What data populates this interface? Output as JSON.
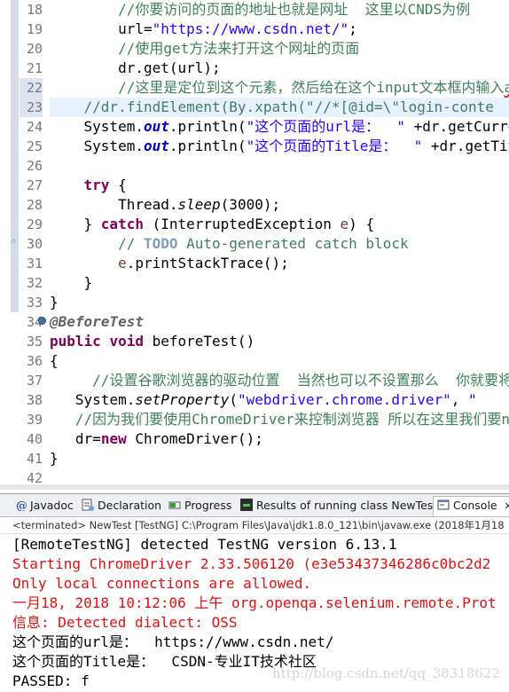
{
  "editor": {
    "line_numbers": [
      "18",
      "19",
      "20",
      "21",
      "22",
      "23",
      "24",
      "25",
      "26",
      "27",
      "28",
      "29",
      "30",
      "31",
      "32",
      "33",
      "34",
      "35",
      "36",
      "37",
      "38",
      "39",
      "40",
      "41",
      "42"
    ],
    "lines": [
      {
        "indent": "        ",
        "tokens": [
          {
            "t": "//你要访问的页面的地址也就是网址  这里以CNDS为例",
            "c": "cmt"
          }
        ]
      },
      {
        "indent": "        ",
        "tokens": [
          {
            "t": "url=",
            "c": ""
          },
          {
            "t": "\"https://www.csdn.net/\"",
            "c": "str"
          },
          {
            "t": ";",
            "c": ""
          }
        ]
      },
      {
        "indent": "        ",
        "tokens": [
          {
            "t": "//使用get方法来打开这个网址的页面",
            "c": "cmt"
          }
        ]
      },
      {
        "indent": "        ",
        "tokens": [
          {
            "t": "dr.get(url);",
            "c": ""
          }
        ]
      },
      {
        "indent": "        ",
        "tokens": [
          {
            "t": "//这里是定位到这个元素，然后给在这个input文本框内输入",
            "c": "cmt"
          },
          {
            "t": "admin",
            "c": "cmt squiggle"
          }
        ]
      },
      {
        "indent": "    ",
        "tokens": [
          {
            "t": "//dr.findElement(By.xpath(\"//*[@id=\\\"login-conte",
            "c": "cmt"
          }
        ]
      },
      {
        "indent": "    ",
        "tokens": [
          {
            "t": "System.",
            "c": ""
          },
          {
            "t": "out",
            "c": "field"
          },
          {
            "t": ".println(",
            "c": ""
          },
          {
            "t": "\"这个页面的url是：  \"",
            "c": "str"
          },
          {
            "t": " +dr.getCurre",
            "c": ""
          }
        ]
      },
      {
        "indent": "    ",
        "tokens": [
          {
            "t": "System.",
            "c": ""
          },
          {
            "t": "out",
            "c": "field"
          },
          {
            "t": ".println(",
            "c": ""
          },
          {
            "t": "\"这个页面的Title是：  \"",
            "c": "str"
          },
          {
            "t": " +dr.getTit",
            "c": ""
          }
        ]
      },
      {
        "indent": "",
        "tokens": []
      },
      {
        "indent": "    ",
        "tokens": [
          {
            "t": "try",
            "c": "kw"
          },
          {
            "t": " {",
            "c": ""
          }
        ]
      },
      {
        "indent": "        ",
        "tokens": [
          {
            "t": "Thread.",
            "c": ""
          },
          {
            "t": "sleep",
            "c": "smeth"
          },
          {
            "t": "(3000);",
            "c": ""
          }
        ]
      },
      {
        "indent": "    ",
        "tokens": [
          {
            "t": "} ",
            "c": ""
          },
          {
            "t": "catch",
            "c": "kw"
          },
          {
            "t": " (InterruptedException ",
            "c": ""
          },
          {
            "t": "e",
            "c": "var"
          },
          {
            "t": ") {",
            "c": ""
          }
        ]
      },
      {
        "indent": "        ",
        "tokens": [
          {
            "t": "// ",
            "c": "cmt"
          },
          {
            "t": "TODO",
            "c": "todo"
          },
          {
            "t": " Auto-generated catch block",
            "c": "cmt"
          }
        ]
      },
      {
        "indent": "        ",
        "tokens": [
          {
            "t": "e",
            "c": "var"
          },
          {
            "t": ".printStackTrace();",
            "c": ""
          }
        ]
      },
      {
        "indent": "    ",
        "tokens": [
          {
            "t": "}",
            "c": ""
          }
        ]
      },
      {
        "indent": "",
        "tokens": [
          {
            "t": "}",
            "c": ""
          }
        ]
      },
      {
        "indent": "",
        "tokens": [
          {
            "t": "@BeforeTest",
            "c": "ann"
          }
        ]
      },
      {
        "indent": "",
        "tokens": [
          {
            "t": "public",
            "c": "kw"
          },
          {
            "t": " ",
            "c": ""
          },
          {
            "t": "void",
            "c": "kw"
          },
          {
            "t": " beforeTest()",
            "c": ""
          }
        ]
      },
      {
        "indent": "",
        "tokens": [
          {
            "t": "{",
            "c": ""
          }
        ]
      },
      {
        "indent": "     ",
        "tokens": [
          {
            "t": "//设置谷歌浏览器的驱动位置  当然也可以不设置那么  你就要将这个",
            "c": "cmt"
          }
        ]
      },
      {
        "indent": "   ",
        "tokens": [
          {
            "t": "System.",
            "c": ""
          },
          {
            "t": "setProperty",
            "c": "smeth"
          },
          {
            "t": "(",
            "c": ""
          },
          {
            "t": "\"webdriver.chrome.driver\"",
            "c": "str"
          },
          {
            "t": ", ",
            "c": ""
          },
          {
            "t": "\"",
            "c": "str"
          }
        ]
      },
      {
        "indent": "   ",
        "tokens": [
          {
            "t": "//因为我们要使用ChromeDriver来控制浏览器 所以在这里我们要n",
            "c": "cmt"
          }
        ]
      },
      {
        "indent": "   ",
        "tokens": [
          {
            "t": "dr=",
            "c": ""
          },
          {
            "t": "new",
            "c": "kw"
          },
          {
            "t": " ChromeDriver();",
            "c": ""
          }
        ]
      },
      {
        "indent": "",
        "tokens": [
          {
            "t": "}",
            "c": ""
          }
        ]
      },
      {
        "indent": "",
        "tokens": []
      }
    ]
  },
  "console": {
    "tabs": [
      {
        "label": "Javadoc",
        "icon": "javadoc-icon"
      },
      {
        "label": "Declaration",
        "icon": "declaration-icon"
      },
      {
        "label": "Progress",
        "icon": "progress-icon"
      },
      {
        "label": "Results of running class NewTest",
        "icon": "testng-results-icon"
      },
      {
        "label": "Console",
        "icon": "console-icon"
      }
    ],
    "close_glyph": "✕",
    "status": "<terminated> NewTest [TestNG] C:\\Program Files\\Java\\jdk1.8.0_121\\bin\\javaw.exe (2018年1月18",
    "output": [
      {
        "text": "[RemoteTestNG] detected TestNG version 6.13.1",
        "err": false
      },
      {
        "text": "Starting ChromeDriver 2.33.506120 (e3e53437346286c0bc2d2",
        "err": true
      },
      {
        "text": "Only local connections are allowed.",
        "err": true
      },
      {
        "text": "一月18, 2018 10:12:06 上午 org.openqa.selenium.remote.Prot",
        "err": true
      },
      {
        "text": "信息: Detected dialect: OSS",
        "err": true
      },
      {
        "text": "这个页面的url是：  https://www.csdn.net/",
        "err": false
      },
      {
        "text": "这个页面的Title是：  CSDN-专业IT技术社区",
        "err": false
      },
      {
        "text": "PASSED: f",
        "err": false
      }
    ],
    "watermark": "http://blog.csdn.net/qq_38318622"
  },
  "colors": {
    "keyword": "#7f0055",
    "string": "#2a00ff",
    "comment": "#3f7f5f",
    "error": "#e01010"
  }
}
